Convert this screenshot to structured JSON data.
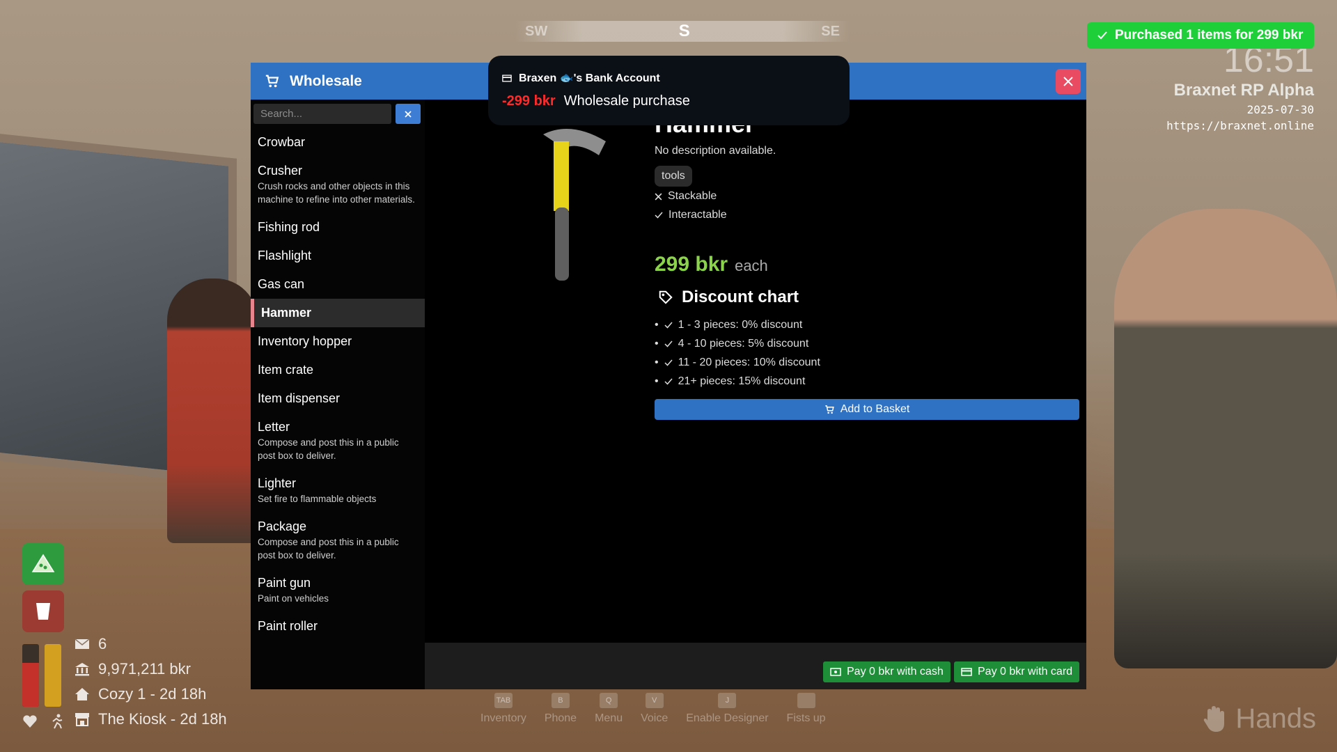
{
  "compass": {
    "left": "SW",
    "center": "S",
    "right": "SE"
  },
  "toast": {
    "text": "Purchased 1 items for 299 bkr",
    "color": "#1fcf3a"
  },
  "server": {
    "clock": "16:51",
    "name": "Braxnet RP Alpha",
    "date": "2025-07-30",
    "url": "https://braxnet.online"
  },
  "bank": {
    "account": "Braxen 🐟's Bank Account",
    "amount": "-299 bkr",
    "description": "Wholesale purchase"
  },
  "window": {
    "title": "Wholesale",
    "accent": "#2f72c4"
  },
  "search": {
    "placeholder": "Search..."
  },
  "items": [
    {
      "name": "Crowbar",
      "desc": ""
    },
    {
      "name": "Crusher",
      "desc": "Crush rocks and other objects in this machine to refine into other materials."
    },
    {
      "name": "Fishing rod",
      "desc": ""
    },
    {
      "name": "Flashlight",
      "desc": ""
    },
    {
      "name": "Gas can",
      "desc": ""
    },
    {
      "name": "Hammer",
      "desc": ""
    },
    {
      "name": "Inventory hopper",
      "desc": ""
    },
    {
      "name": "Item crate",
      "desc": ""
    },
    {
      "name": "Item dispenser",
      "desc": ""
    },
    {
      "name": "Letter",
      "desc": "Compose and post this in a public post box to deliver."
    },
    {
      "name": "Lighter",
      "desc": "Set fire to flammable objects"
    },
    {
      "name": "Package",
      "desc": "Compose and post this in a public post box to deliver."
    },
    {
      "name": "Paint gun",
      "desc": "Paint on vehicles"
    },
    {
      "name": "Paint roller",
      "desc": ""
    }
  ],
  "detail": {
    "title": "Hammer",
    "description": "No description available.",
    "tag": "tools",
    "stackable": "Stackable",
    "interactable": "Interactable",
    "price": "299 bkr",
    "price_unit": "each",
    "discount_title": "Discount chart",
    "discounts": [
      "1 - 3 pieces: 0% discount",
      "4 - 10 pieces: 5% discount",
      "11 - 20 pieces: 10% discount",
      "21+ pieces: 15% discount"
    ],
    "add_label": "Add to Basket"
  },
  "footer": {
    "pay_cash": "Pay 0 bkr with cash",
    "pay_card": "Pay 0 bkr with card"
  },
  "hud": {
    "mail": "6",
    "money": "9,971,211 bkr",
    "home": "Cozy 1 - 2d 18h",
    "shop": "The Kiosk - 2d 18h"
  },
  "actions": [
    {
      "key": "TAB",
      "label": "Inventory"
    },
    {
      "key": "B",
      "label": "Phone"
    },
    {
      "key": "Q",
      "label": "Menu"
    },
    {
      "key": "V",
      "label": "Voice"
    },
    {
      "key": "J",
      "label": "Enable Designer"
    },
    {
      "key": "",
      "label": "Fists up"
    }
  ],
  "hands_label": "Hands"
}
